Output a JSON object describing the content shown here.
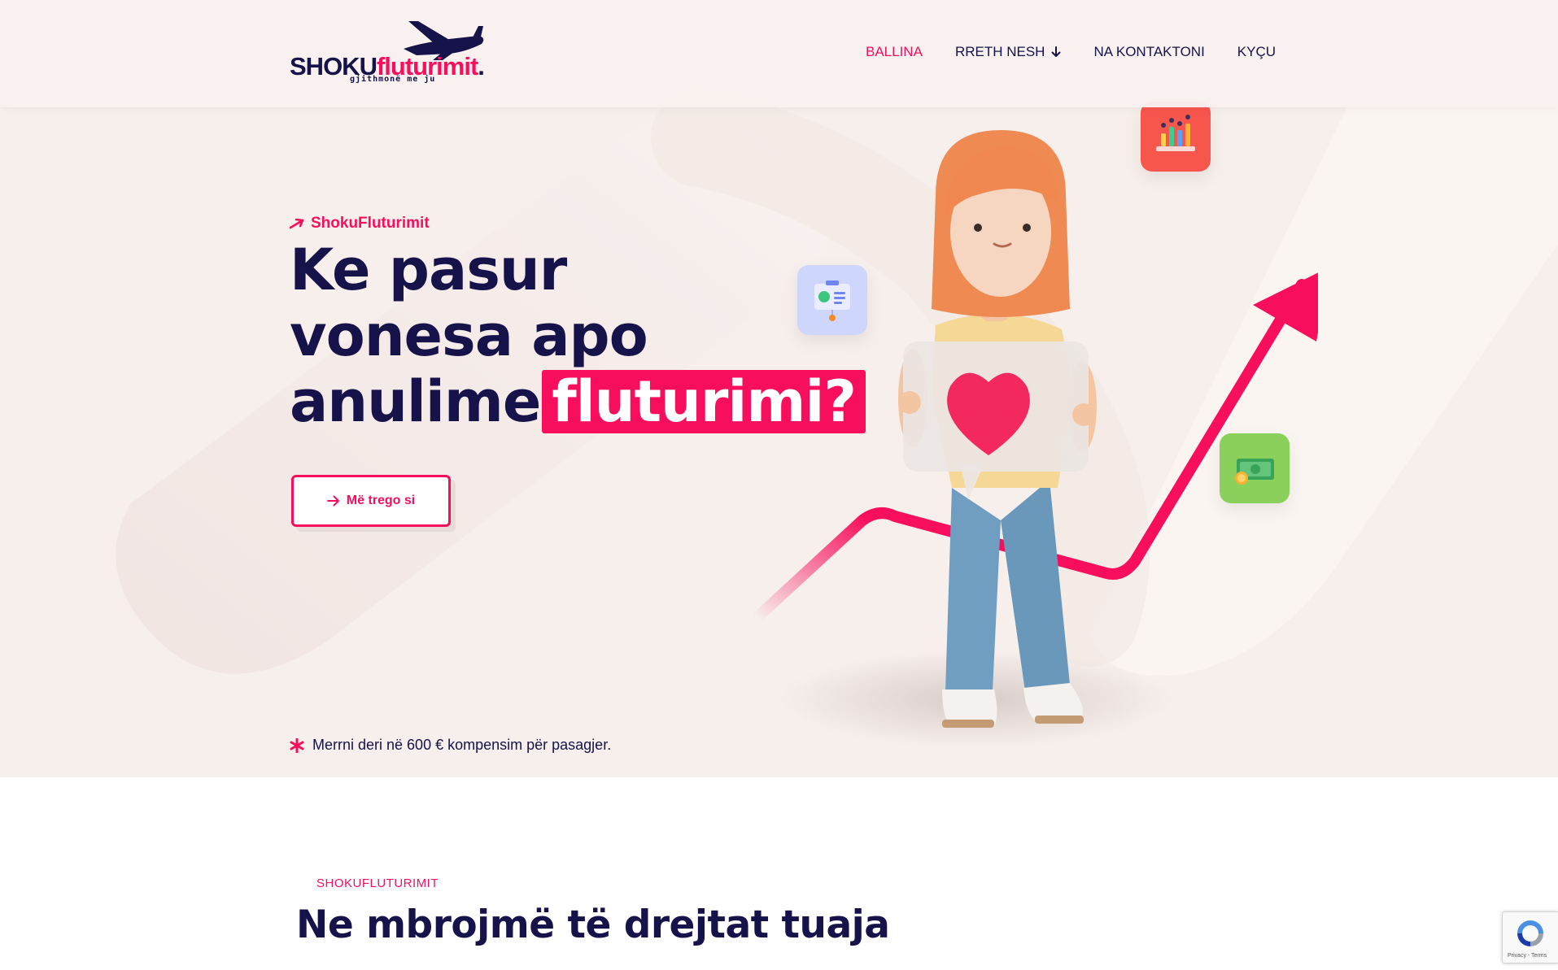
{
  "brand": {
    "name_main": "SHOKU",
    "name_accent": "fluturimit",
    "name_dot": ".",
    "tagline": "gjithmonë me ju"
  },
  "nav": {
    "items": [
      {
        "label": "BALLINA",
        "active": true
      },
      {
        "label": "RRETH NESH",
        "active": false,
        "dropdown": true
      },
      {
        "label": "NA KONTAKTONI",
        "active": false
      },
      {
        "label": "KYÇU",
        "active": false
      }
    ]
  },
  "hero": {
    "eyebrow": "ShokuFluturimit",
    "headline_line1": "Ke pasur",
    "headline_line2": "vonesa apo",
    "headline_line3": "anulime",
    "headline_highlight": "fluturimi?",
    "cta_label": "Më trego si",
    "footnote": "Merrni deri në 600 € kompensim për pasagjer."
  },
  "section2": {
    "label": "SHOKUFLUTURIMIT",
    "title": "Ne mbrojmë të drejtat tuaja"
  },
  "recaptcha": {
    "terms": "Privacy - Terms"
  },
  "colors": {
    "accent": "#f70f5d",
    "navy": "#16134a",
    "hero_bg": "#f7efec"
  },
  "icons": {
    "eyebrow": "arrow-up-right-icon",
    "cta": "arrow-right-icon",
    "footnote": "asterisk-icon",
    "nav_dropdown": "arrow-down-icon"
  }
}
